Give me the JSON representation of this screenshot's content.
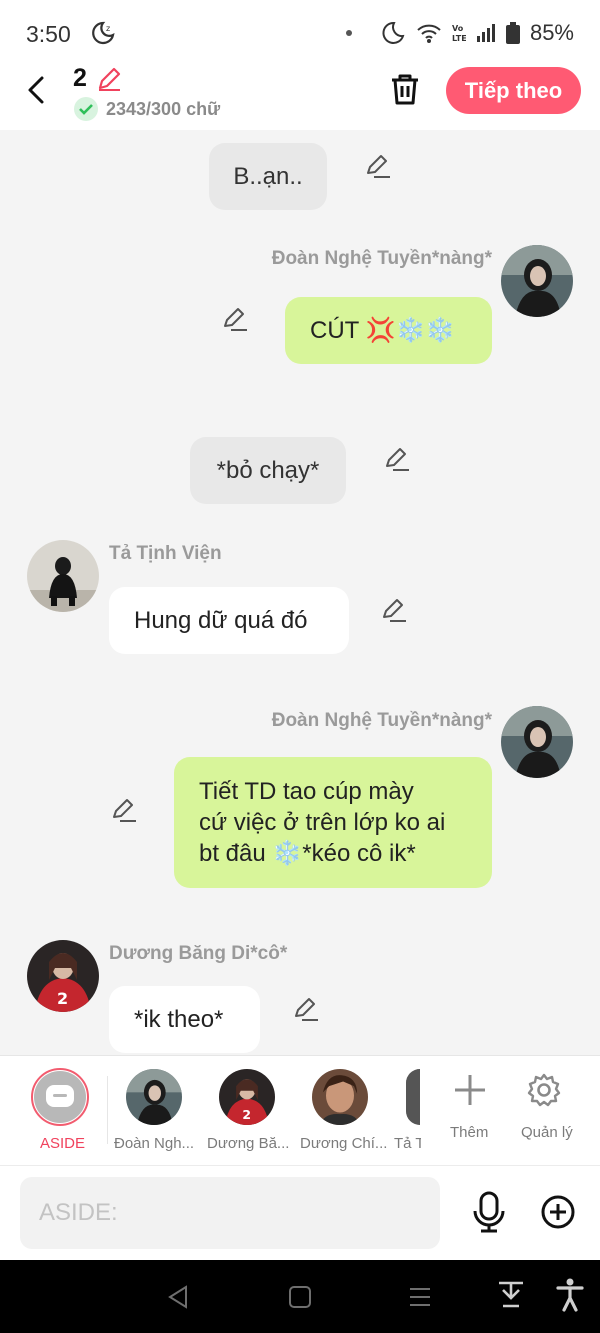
{
  "status_bar": {
    "time": "3:50",
    "battery": "85%"
  },
  "header": {
    "count": "2",
    "word_count": "2343/300 chữ",
    "next_label": "Tiếp theo"
  },
  "messages": [
    {
      "type": "narration",
      "text": "B..ạn.."
    },
    {
      "type": "right",
      "sender": "Đoàn Nghệ Tuyền*nàng*",
      "text": "CÚT 💢❄️❄️"
    },
    {
      "type": "narration",
      "text": "*bỏ chạy*"
    },
    {
      "type": "left",
      "sender": "Tả Tịnh Viện",
      "text": "Hung dữ quá đó"
    },
    {
      "type": "right",
      "sender": "Đoàn Nghệ Tuyền*nàng*",
      "lines": [
        "Tiết TD tao cúp mày",
        "cứ việc ở trên lớp ko ai",
        "bt đâu ❄️*kéo cô ik*"
      ]
    },
    {
      "type": "left",
      "sender": "Dương Băng Di*cô*",
      "text": "*ik theo*"
    }
  ],
  "character_bar": {
    "aside_label": "ASIDE",
    "characters": [
      "Đoàn Ngh...",
      "Dương Bă...",
      "Dương Chí...",
      "Tả T"
    ],
    "add_label": "Thêm",
    "manage_label": "Quản lý"
  },
  "input": {
    "placeholder": "ASIDE:"
  },
  "colors": {
    "accent": "#ff5a73",
    "right_bubble": "#d8f59a",
    "narration_bubble": "#e8e8e8"
  }
}
